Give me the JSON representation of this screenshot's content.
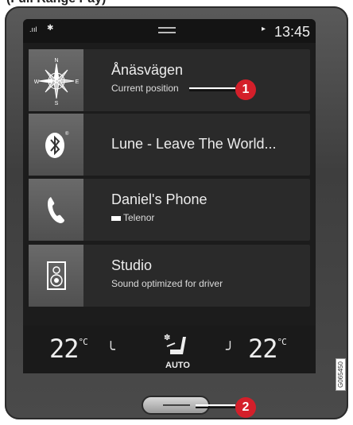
{
  "header_fragment": "(Full Range Pay)",
  "status_bar": {
    "signal": ".ııl",
    "bluetooth": "✱",
    "play": "▸",
    "time": "13:45"
  },
  "tiles": [
    {
      "icon": "compass-icon",
      "title": "Ånäsvägen",
      "subtitle": "Current position"
    },
    {
      "icon": "bluetooth-icon",
      "title": "Lune - Leave The World...",
      "subtitle": ""
    },
    {
      "icon": "phone-icon",
      "title": "Daniel's Phone",
      "subtitle": "Telenor"
    },
    {
      "icon": "speaker-icon",
      "title": "Studio",
      "subtitle": "Sound optimized for driver"
    }
  ],
  "compass_letters": {
    "n": "N",
    "e": "E",
    "s": "S",
    "w": "W"
  },
  "climate": {
    "left_temp": "22",
    "right_temp": "22",
    "unit": "°C",
    "fan_mode": "AUTO"
  },
  "callouts": {
    "one": "1",
    "two": "2"
  },
  "image_id": "G065450",
  "colors": {
    "callout": "#d41f2a",
    "screen": "#1c1c1c",
    "tile": "#2a2a2a"
  }
}
